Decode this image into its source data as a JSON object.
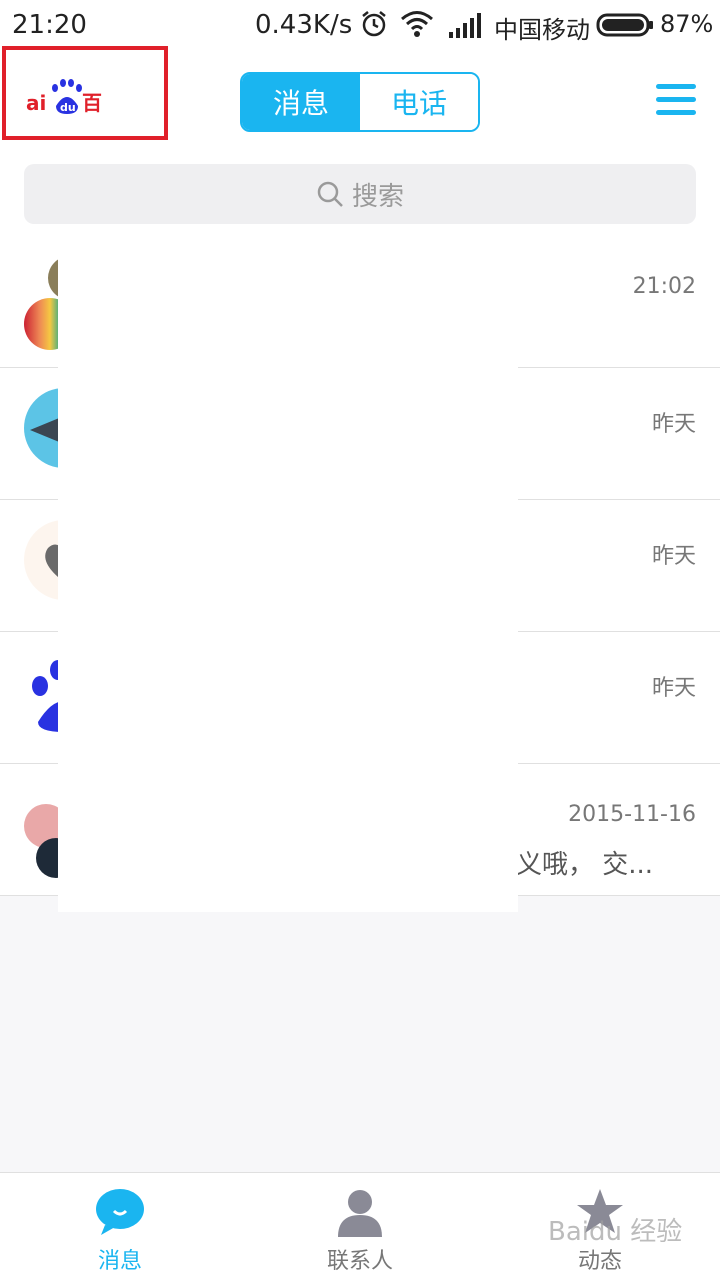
{
  "status_bar": {
    "time": "21:20",
    "speed": "0.43K/s",
    "carrier": "中国移动",
    "battery": "87%"
  },
  "header": {
    "logo_text": "Bai du 百",
    "tabs": [
      {
        "label": "消息",
        "active": true
      },
      {
        "label": "电话",
        "active": false
      }
    ],
    "menu_icon": "menu-icon"
  },
  "search": {
    "placeholder": "搜索",
    "icon": "search-icon"
  },
  "messages": [
    {
      "time": "21:02",
      "preview": ""
    },
    {
      "time": "昨天",
      "preview": ""
    },
    {
      "time": "昨天",
      "preview": ""
    },
    {
      "time": "昨天",
      "preview": ""
    },
    {
      "time": "2015-11-16",
      "preview": "义哦， 交..."
    }
  ],
  "tabbar": [
    {
      "label": "消息",
      "icon": "chat-bubble-icon",
      "active": true
    },
    {
      "label": "联系人",
      "icon": "person-icon",
      "active": false
    },
    {
      "label": "动态",
      "icon": "star-icon",
      "active": false
    }
  ],
  "watermark": "Baidu 经验",
  "colors": {
    "accent": "#1ab5f0",
    "highlight_box": "#e0202a",
    "background": "#f7f7f9"
  }
}
